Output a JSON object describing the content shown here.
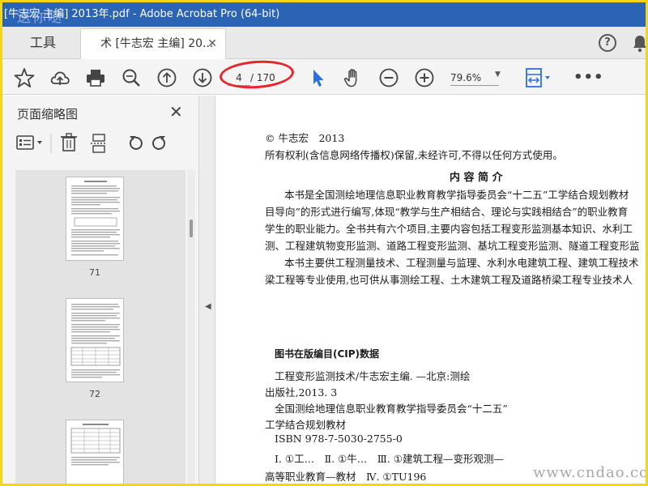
{
  "window": {
    "title": "[牛志宏 主编] 2013年.pdf - Adobe Acrobat Pro (64-bit)",
    "watermark_top": "送你哒"
  },
  "tabs": {
    "tools_label": "工具",
    "document_label": "术 [牛志宏 主编] 20...",
    "close_glyph": "✕",
    "help_glyph": "?"
  },
  "toolbar": {
    "current_page": "4",
    "total_pages": "/ 170",
    "zoom": "79.6%",
    "more": "•••"
  },
  "left_panel": {
    "title": "页面缩略图",
    "close_glyph": "✕",
    "thumbnails": [
      {
        "page_label": "71"
      },
      {
        "page_label": "72"
      },
      {
        "page_label": ""
      }
    ]
  },
  "document": {
    "copyright": "© 牛志宏　2013",
    "rights": "所有权利(含信息网络传播权)保留,未经许可,不得以任何方式使用。",
    "section_heading": "内 容 简 介",
    "para1": [
      "本书是全国测绘地理信息职业教育教学指导委员会“十二五”工学结合规划教材",
      "目导向”的形式进行编写,体现“教学与生产相结合、理论与实践相结合”的职业教育",
      "学生的职业能力。全书共有六个项目,主要内容包括工程变形监测基本知识、水利工",
      "测、工程建筑物变形监测、道路工程变形监测、基坑工程变形监测、隧道工程变形监"
    ],
    "para2": [
      "本书主要供工程测量技术、工程测量与监理、水利水电建筑工程、建筑工程技术",
      "梁工程等专业使用,也可供从事测绘工程、土木建筑工程及道路桥梁工程专业技术人"
    ],
    "cip_heading": "图书在版编目(CIP)数据",
    "cip_lines": [
      "工程变形监测技术/牛志宏主编. —北京:测绘",
      "出版社,2013. 3",
      "全国测绘地理信息职业教育教学指导委员会“十二五”",
      "工学结合规划教材",
      "ISBN 978-7-5030-2755-0",
      "Ⅰ. ①工…　Ⅱ. ①牛…　Ⅲ. ①建筑工程—变形观测—",
      "高等职业教育—教材　Ⅳ. ①TU196"
    ],
    "watermark_bottom": "www.cndao.com"
  }
}
